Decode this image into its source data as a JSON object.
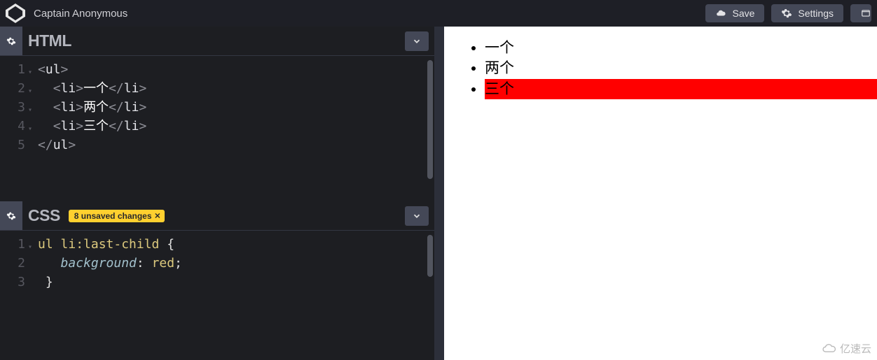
{
  "header": {
    "pen_title": "Captain Anonymous",
    "buttons": {
      "save": "Save",
      "settings": "Settings"
    },
    "icons": {
      "save": "cloud",
      "settings": "gear"
    }
  },
  "panels": {
    "html": {
      "title": "HTML",
      "lines": [
        "1",
        "2",
        "3",
        "4",
        "5"
      ],
      "code_tokens": {
        "ul_open_lt": "<",
        "ul_open_tag": "ul",
        "ul_open_gt": ">",
        "li_open_lt": "<",
        "li_open_tag": "li",
        "li_open_gt": ">",
        "li_close_lt": "</",
        "li_close_tag": "li",
        "li_close_gt": ">",
        "ul_close_lt": "</",
        "ul_close_tag": "ul",
        "ul_close_gt": ">",
        "txt1": "一个",
        "txt2": "两个",
        "txt3": "三个"
      }
    },
    "css": {
      "title": "CSS",
      "unsaved_label": "8 unsaved changes",
      "lines": [
        "1",
        "2",
        "3"
      ],
      "code_tokens": {
        "sel": "ul li",
        "pseudo": ":last-child",
        "brace_open": " {",
        "indent": "   ",
        "prop": "background",
        "colon": ": ",
        "val": "red",
        "semi": ";",
        "brace_close": " }"
      }
    }
  },
  "preview": {
    "items": [
      "一个",
      "两个",
      "三个"
    ],
    "highlight_color": "#ff0000"
  },
  "watermark": "亿速云"
}
